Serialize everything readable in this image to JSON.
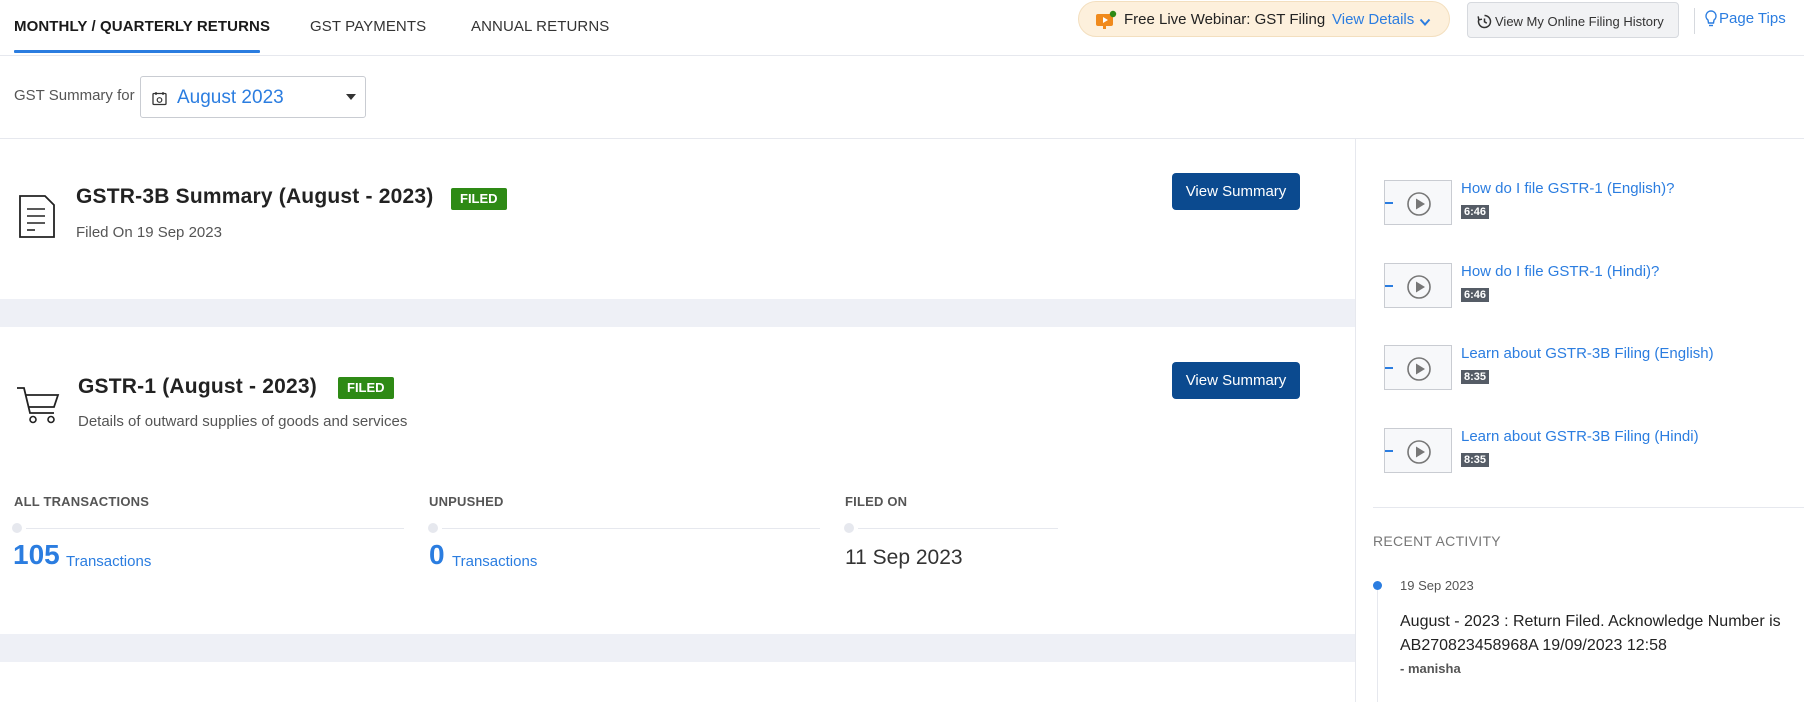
{
  "tabs": [
    {
      "label": "MONTHLY / QUARTERLY RETURNS",
      "active": true
    },
    {
      "label": "GST PAYMENTS",
      "active": false
    },
    {
      "label": "ANNUAL RETURNS",
      "active": false
    }
  ],
  "webinar": {
    "text": "Free Live Webinar: GST Filing",
    "link": "View Details"
  },
  "history_button": "View My Online Filing History",
  "page_tips": "Page Tips",
  "summary": {
    "label": "GST Summary for",
    "period": "August 2023"
  },
  "gstr3b": {
    "title": "GSTR-3B Summary (August - 2023)",
    "badge": "FILED",
    "subtitle": "Filed On 19 Sep 2023",
    "button": "View Summary"
  },
  "gstr1": {
    "title": "GSTR-1 (August - 2023)",
    "badge": "FILED",
    "subtitle": "Details of outward supplies of goods and services",
    "button": "View Summary",
    "stats": {
      "all_label": "ALL TRANSACTIONS",
      "all_value": "105",
      "all_unit": "Transactions",
      "unpushed_label": "UNPUSHED",
      "unpushed_value": "0",
      "unpushed_unit": "Transactions",
      "filed_label": "FILED ON",
      "filed_value": "11 Sep 2023"
    }
  },
  "videos": [
    {
      "title": "How do I file GSTR-1 (English)?",
      "duration": "6:46"
    },
    {
      "title": "How do I file GSTR-1 (Hindi)?",
      "duration": "6:46"
    },
    {
      "title": "Learn about GSTR-3B Filing (English)",
      "duration": "8:35"
    },
    {
      "title": "Learn about GSTR-3B Filing (Hindi)",
      "duration": "8:35"
    }
  ],
  "recent_activity": {
    "heading": "RECENT ACTIVITY",
    "items": [
      {
        "date": "19 Sep 2023",
        "text": "August - 2023 : Return Filed. Acknowledge Number is AB270823458968A 19/09/2023 12:58",
        "user": "- manisha"
      }
    ]
  },
  "colors": {
    "accent": "#2b7de0",
    "primary_button": "#0b4a8f",
    "filed_badge": "#2e8a15",
    "band": "#eef0f6"
  }
}
